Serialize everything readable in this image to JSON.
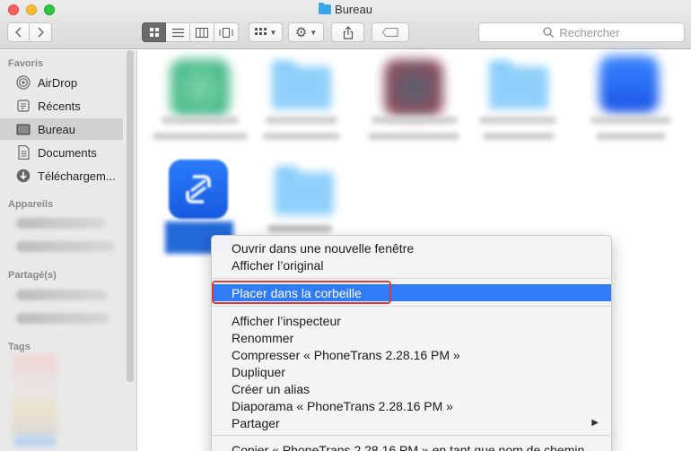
{
  "window": {
    "title": "Bureau"
  },
  "toolbar": {
    "back_icon": "chevron-left-icon",
    "forward_icon": "chevron-right-icon",
    "view_modes": [
      "icon-view-icon",
      "list-view-icon",
      "column-view-icon",
      "cover-flow-icon"
    ],
    "active_view": "icon-view-icon",
    "search_placeholder": "Rechercher"
  },
  "sidebar": {
    "favorites_header": "Favoris",
    "favorites": [
      {
        "label": "AirDrop",
        "icon": "airdrop-icon"
      },
      {
        "label": "Récents",
        "icon": "recents-icon"
      },
      {
        "label": "Bureau",
        "icon": "desktop-icon",
        "selected": true
      },
      {
        "label": "Documents",
        "icon": "documents-icon"
      },
      {
        "label": "Téléchargem...",
        "icon": "downloads-icon"
      }
    ],
    "devices_header": "Appareils",
    "shared_header": "Partagé(s)",
    "tags_header": "Tags"
  },
  "context_menu": {
    "items": [
      {
        "label": "Ouvrir dans une nouvelle fenêtre"
      },
      {
        "label": "Afficher l’original"
      },
      {
        "label": "Placer dans la corbeille",
        "highlighted": true
      },
      {
        "label": "Afficher l’inspecteur"
      },
      {
        "label": "Renommer"
      },
      {
        "label": "Compresser « PhoneTrans 2.28.16 PM »"
      },
      {
        "label": "Dupliquer"
      },
      {
        "label": "Créer un alias"
      },
      {
        "label": "Diaporama « PhoneTrans 2.28.16 PM »"
      },
      {
        "label": "Partager",
        "has_submenu": true
      },
      {
        "label": "Copier « PhoneTrans 2.28.16 PM » en tant que nom de chemin"
      }
    ]
  },
  "colors": {
    "accent": "#2f7cf6",
    "highlight_box": "#e03a3a",
    "folder": "#8fd0fa"
  }
}
